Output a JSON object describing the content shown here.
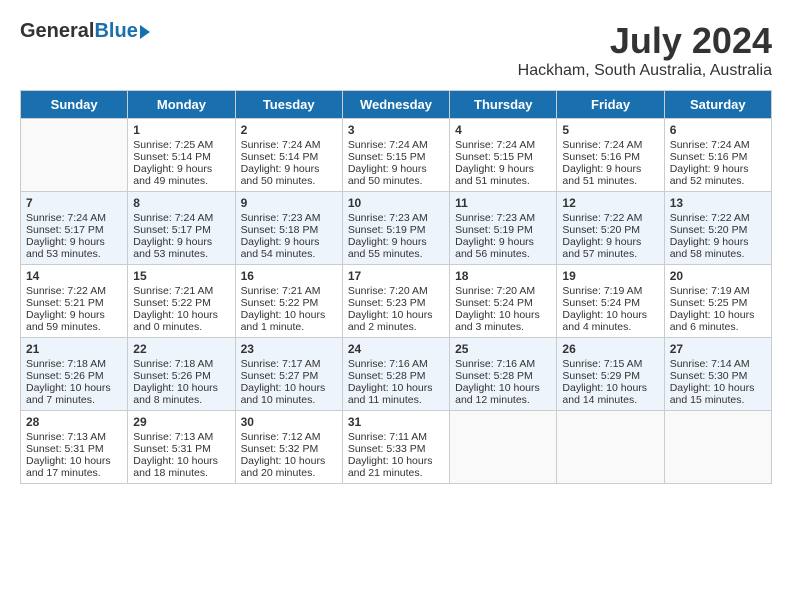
{
  "header": {
    "logo_general": "General",
    "logo_blue": "Blue",
    "title": "July 2024",
    "subtitle": "Hackham, South Australia, Australia"
  },
  "days_of_week": [
    "Sunday",
    "Monday",
    "Tuesday",
    "Wednesday",
    "Thursday",
    "Friday",
    "Saturday"
  ],
  "weeks": [
    [
      {
        "day": "",
        "sunrise": "",
        "sunset": "",
        "daylight": ""
      },
      {
        "day": "1",
        "sunrise": "Sunrise: 7:25 AM",
        "sunset": "Sunset: 5:14 PM",
        "daylight": "Daylight: 9 hours and 49 minutes."
      },
      {
        "day": "2",
        "sunrise": "Sunrise: 7:24 AM",
        "sunset": "Sunset: 5:14 PM",
        "daylight": "Daylight: 9 hours and 50 minutes."
      },
      {
        "day": "3",
        "sunrise": "Sunrise: 7:24 AM",
        "sunset": "Sunset: 5:15 PM",
        "daylight": "Daylight: 9 hours and 50 minutes."
      },
      {
        "day": "4",
        "sunrise": "Sunrise: 7:24 AM",
        "sunset": "Sunset: 5:15 PM",
        "daylight": "Daylight: 9 hours and 51 minutes."
      },
      {
        "day": "5",
        "sunrise": "Sunrise: 7:24 AM",
        "sunset": "Sunset: 5:16 PM",
        "daylight": "Daylight: 9 hours and 51 minutes."
      },
      {
        "day": "6",
        "sunrise": "Sunrise: 7:24 AM",
        "sunset": "Sunset: 5:16 PM",
        "daylight": "Daylight: 9 hours and 52 minutes."
      }
    ],
    [
      {
        "day": "7",
        "sunrise": "Sunrise: 7:24 AM",
        "sunset": "Sunset: 5:17 PM",
        "daylight": "Daylight: 9 hours and 53 minutes."
      },
      {
        "day": "8",
        "sunrise": "Sunrise: 7:24 AM",
        "sunset": "Sunset: 5:17 PM",
        "daylight": "Daylight: 9 hours and 53 minutes."
      },
      {
        "day": "9",
        "sunrise": "Sunrise: 7:23 AM",
        "sunset": "Sunset: 5:18 PM",
        "daylight": "Daylight: 9 hours and 54 minutes."
      },
      {
        "day": "10",
        "sunrise": "Sunrise: 7:23 AM",
        "sunset": "Sunset: 5:19 PM",
        "daylight": "Daylight: 9 hours and 55 minutes."
      },
      {
        "day": "11",
        "sunrise": "Sunrise: 7:23 AM",
        "sunset": "Sunset: 5:19 PM",
        "daylight": "Daylight: 9 hours and 56 minutes."
      },
      {
        "day": "12",
        "sunrise": "Sunrise: 7:22 AM",
        "sunset": "Sunset: 5:20 PM",
        "daylight": "Daylight: 9 hours and 57 minutes."
      },
      {
        "day": "13",
        "sunrise": "Sunrise: 7:22 AM",
        "sunset": "Sunset: 5:20 PM",
        "daylight": "Daylight: 9 hours and 58 minutes."
      }
    ],
    [
      {
        "day": "14",
        "sunrise": "Sunrise: 7:22 AM",
        "sunset": "Sunset: 5:21 PM",
        "daylight": "Daylight: 9 hours and 59 minutes."
      },
      {
        "day": "15",
        "sunrise": "Sunrise: 7:21 AM",
        "sunset": "Sunset: 5:22 PM",
        "daylight": "Daylight: 10 hours and 0 minutes."
      },
      {
        "day": "16",
        "sunrise": "Sunrise: 7:21 AM",
        "sunset": "Sunset: 5:22 PM",
        "daylight": "Daylight: 10 hours and 1 minute."
      },
      {
        "day": "17",
        "sunrise": "Sunrise: 7:20 AM",
        "sunset": "Sunset: 5:23 PM",
        "daylight": "Daylight: 10 hours and 2 minutes."
      },
      {
        "day": "18",
        "sunrise": "Sunrise: 7:20 AM",
        "sunset": "Sunset: 5:24 PM",
        "daylight": "Daylight: 10 hours and 3 minutes."
      },
      {
        "day": "19",
        "sunrise": "Sunrise: 7:19 AM",
        "sunset": "Sunset: 5:24 PM",
        "daylight": "Daylight: 10 hours and 4 minutes."
      },
      {
        "day": "20",
        "sunrise": "Sunrise: 7:19 AM",
        "sunset": "Sunset: 5:25 PM",
        "daylight": "Daylight: 10 hours and 6 minutes."
      }
    ],
    [
      {
        "day": "21",
        "sunrise": "Sunrise: 7:18 AM",
        "sunset": "Sunset: 5:26 PM",
        "daylight": "Daylight: 10 hours and 7 minutes."
      },
      {
        "day": "22",
        "sunrise": "Sunrise: 7:18 AM",
        "sunset": "Sunset: 5:26 PM",
        "daylight": "Daylight: 10 hours and 8 minutes."
      },
      {
        "day": "23",
        "sunrise": "Sunrise: 7:17 AM",
        "sunset": "Sunset: 5:27 PM",
        "daylight": "Daylight: 10 hours and 10 minutes."
      },
      {
        "day": "24",
        "sunrise": "Sunrise: 7:16 AM",
        "sunset": "Sunset: 5:28 PM",
        "daylight": "Daylight: 10 hours and 11 minutes."
      },
      {
        "day": "25",
        "sunrise": "Sunrise: 7:16 AM",
        "sunset": "Sunset: 5:28 PM",
        "daylight": "Daylight: 10 hours and 12 minutes."
      },
      {
        "day": "26",
        "sunrise": "Sunrise: 7:15 AM",
        "sunset": "Sunset: 5:29 PM",
        "daylight": "Daylight: 10 hours and 14 minutes."
      },
      {
        "day": "27",
        "sunrise": "Sunrise: 7:14 AM",
        "sunset": "Sunset: 5:30 PM",
        "daylight": "Daylight: 10 hours and 15 minutes."
      }
    ],
    [
      {
        "day": "28",
        "sunrise": "Sunrise: 7:13 AM",
        "sunset": "Sunset: 5:31 PM",
        "daylight": "Daylight: 10 hours and 17 minutes."
      },
      {
        "day": "29",
        "sunrise": "Sunrise: 7:13 AM",
        "sunset": "Sunset: 5:31 PM",
        "daylight": "Daylight: 10 hours and 18 minutes."
      },
      {
        "day": "30",
        "sunrise": "Sunrise: 7:12 AM",
        "sunset": "Sunset: 5:32 PM",
        "daylight": "Daylight: 10 hours and 20 minutes."
      },
      {
        "day": "31",
        "sunrise": "Sunrise: 7:11 AM",
        "sunset": "Sunset: 5:33 PM",
        "daylight": "Daylight: 10 hours and 21 minutes."
      },
      {
        "day": "",
        "sunrise": "",
        "sunset": "",
        "daylight": ""
      },
      {
        "day": "",
        "sunrise": "",
        "sunset": "",
        "daylight": ""
      },
      {
        "day": "",
        "sunrise": "",
        "sunset": "",
        "daylight": ""
      }
    ]
  ]
}
